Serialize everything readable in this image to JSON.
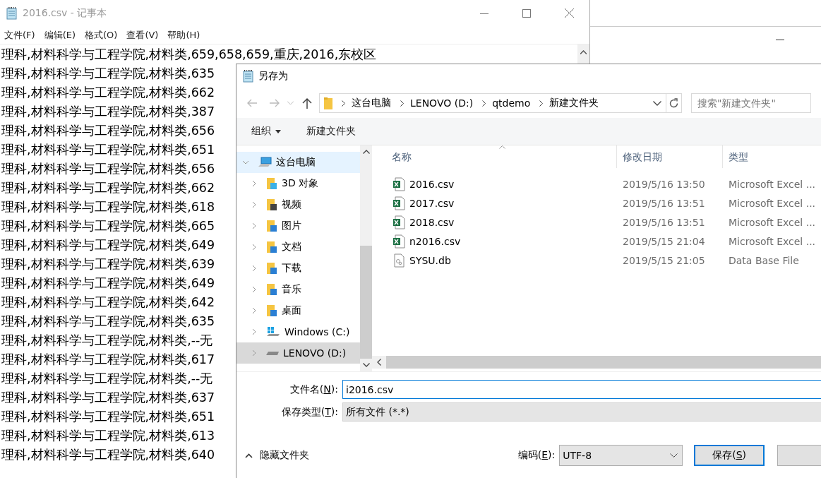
{
  "notepad": {
    "title": "2016.csv - 记事本",
    "menu": [
      "文件(F)",
      "编辑(E)",
      "格式(O)",
      "查看(V)",
      "帮助(H)"
    ],
    "lines": [
      "理科,材料科学与工程学院,材料类,659,658,659,重庆,2016,东校区",
      "理科,材料科学与工程学院,材料类,635",
      "理科,材料科学与工程学院,材料类,662",
      "理科,材料科学与工程学院,材料类,387",
      "理科,材料科学与工程学院,材料类,656",
      "理科,材料科学与工程学院,材料类,651",
      "理科,材料科学与工程学院,材料类,656",
      "理科,材料科学与工程学院,材料类,662",
      "理科,材料科学与工程学院,材料类,618",
      "理科,材料科学与工程学院,材料类,665",
      "理科,材料科学与工程学院,材料类,649",
      "理科,材料科学与工程学院,材料类,639",
      "理科,材料科学与工程学院,材料类,649",
      "理科,材料科学与工程学院,材料类,642",
      "理科,材料科学与工程学院,材料类,635",
      "理科,材料科学与工程学院,材料类,--无",
      "理科,材料科学与工程学院,材料类,617",
      "理科,材料科学与工程学院,材料类,--无",
      "理科,材料科学与工程学院,材料类,637",
      "理科,材料科学与工程学院,材料类,651",
      "理科,材料科学与工程学院,材料类,613",
      "理科,材料科学与工程学院,材料类,640"
    ]
  },
  "dialog": {
    "title": "另存为",
    "breadcrumbs": [
      "这台电脑",
      "LENOVO (D:)",
      "qtdemo",
      "新建文件夹"
    ],
    "search": {
      "placeholder": "搜索\"新建文件夹\""
    },
    "toolbar": {
      "organize": "组织",
      "new_folder": "新建文件夹"
    },
    "nav": [
      {
        "label": "这台电脑",
        "kind": "pc",
        "selected": true,
        "highlighted": false,
        "expanded": true,
        "children": [
          {
            "label": "3D 对象",
            "kind": "objects3d",
            "selected": false,
            "highlighted": false,
            "expanded": false
          },
          {
            "label": "视频",
            "kind": "video",
            "selected": false,
            "highlighted": false,
            "expanded": false
          },
          {
            "label": "图片",
            "kind": "pictures",
            "selected": false,
            "highlighted": false,
            "expanded": false
          },
          {
            "label": "文档",
            "kind": "documents",
            "selected": false,
            "highlighted": false,
            "expanded": false
          },
          {
            "label": "下载",
            "kind": "downloads",
            "selected": false,
            "highlighted": false,
            "expanded": false
          },
          {
            "label": "音乐",
            "kind": "music",
            "selected": false,
            "highlighted": false,
            "expanded": false
          },
          {
            "label": "桌面",
            "kind": "desktop",
            "selected": false,
            "highlighted": false,
            "expanded": false
          },
          {
            "label": "Windows (C:)",
            "kind": "windows-drive",
            "selected": false,
            "highlighted": false,
            "expanded": false
          },
          {
            "label": "LENOVO (D:)",
            "kind": "drive",
            "selected": false,
            "highlighted": true,
            "expanded": false
          }
        ]
      }
    ],
    "columns": [
      "名称",
      "修改日期",
      "类型"
    ],
    "files": [
      {
        "name": "2016.csv",
        "modified": "2019/5/16 13:50",
        "type": "Microsoft Excel ...",
        "kind": "excel"
      },
      {
        "name": "2017.csv",
        "modified": "2019/5/16 13:51",
        "type": "Microsoft Excel ...",
        "kind": "excel"
      },
      {
        "name": "2018.csv",
        "modified": "2019/5/16 13:51",
        "type": "Microsoft Excel ...",
        "kind": "excel"
      },
      {
        "name": "n2016.csv",
        "modified": "2019/5/15 21:04",
        "type": "Microsoft Excel ...",
        "kind": "excel"
      },
      {
        "name": "SYSU.db",
        "modified": "2019/5/15 21:05",
        "type": "Data Base File",
        "kind": "database"
      }
    ],
    "filename": {
      "label": [
        "文件名(",
        "N",
        "):"
      ],
      "value": "i2016.csv"
    },
    "save_type": {
      "label": [
        "保存类型(",
        "T",
        "):"
      ],
      "value": "所有文件  (*.*)"
    },
    "hide_folders": "隐藏文件夹",
    "encoding": {
      "label": [
        "编码(",
        "E",
        "):"
      ],
      "value": "UTF-8"
    },
    "save_button": [
      "保存(",
      "S",
      ")"
    ]
  }
}
